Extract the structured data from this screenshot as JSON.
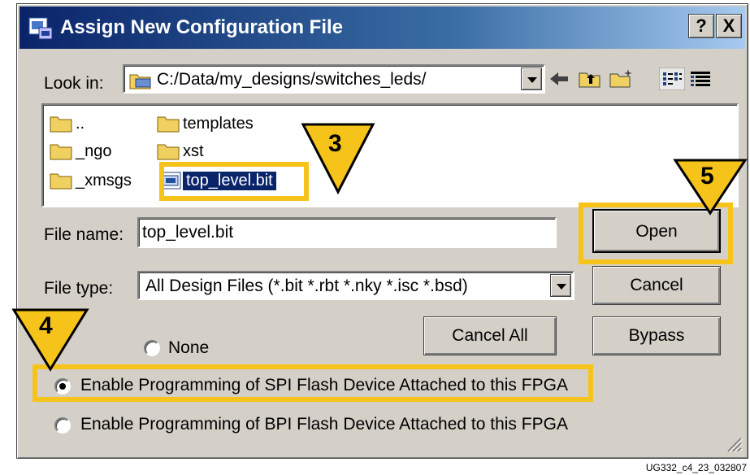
{
  "window": {
    "title": "Assign New Configuration File",
    "help_glyph": "?",
    "close_glyph": "X"
  },
  "look_in": {
    "label": "Look in:",
    "path": "C:/Data/my_designs/switches_leds/",
    "icons": [
      "back-arrow-icon",
      "up-folder-icon",
      "new-folder-icon",
      "list-view-icon",
      "details-view-icon"
    ]
  },
  "files": [
    {
      "name": "..",
      "type": "folder"
    },
    {
      "name": "templates",
      "type": "folder"
    },
    {
      "name": "_ngo",
      "type": "folder"
    },
    {
      "name": "xst",
      "type": "folder"
    },
    {
      "name": "_xmsgs",
      "type": "folder"
    },
    {
      "name": "top_level.bit",
      "type": "bit-file",
      "selected": true
    }
  ],
  "file_name": {
    "label": "File name:",
    "value": "top_level.bit"
  },
  "file_type": {
    "label": "File type:",
    "value": "All Design Files (*.bit *.rbt *.nky *.isc *.bsd)"
  },
  "buttons": {
    "open": "Open",
    "cancel": "Cancel",
    "cancel_all": "Cancel All",
    "bypass": "Bypass"
  },
  "options": [
    {
      "label": "None",
      "checked": false
    },
    {
      "label": "Enable Programming of SPI Flash Device Attached to this FPGA",
      "checked": true
    },
    {
      "label": "Enable Programming of BPI Flash Device Attached to this FPGA",
      "checked": false
    }
  ],
  "callouts": [
    "3",
    "4",
    "5"
  ],
  "callout_color": "#f6c31a",
  "selection_color": "#0a246a",
  "footnote": "UG332_c4_23_032807"
}
